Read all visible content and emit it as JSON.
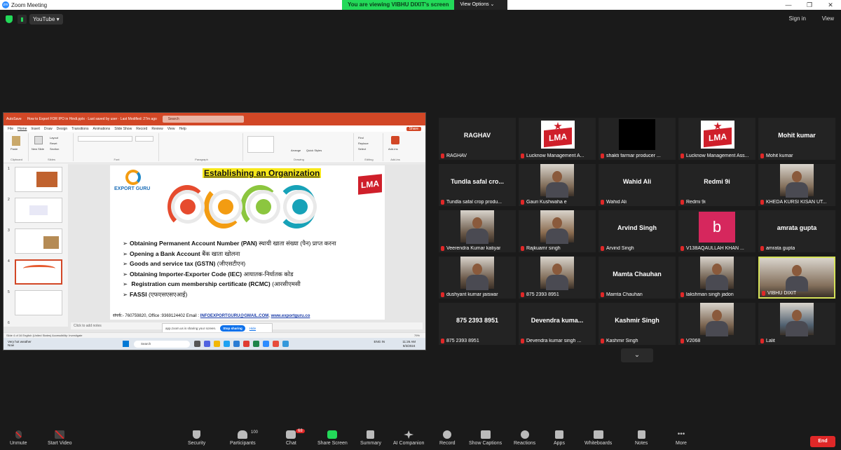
{
  "window": {
    "title": "Zoom Meeting",
    "min": "—",
    "max": "❐",
    "close": "✕"
  },
  "banner": {
    "viewing": "You are viewing VIBHU DIXIT's screen",
    "view_options": "View Options ⌄"
  },
  "topbar": {
    "youtube": "YouTube ▾",
    "sign_in": "Sign in",
    "view": "View"
  },
  "powerpoint": {
    "autosave": "AutoSave",
    "file_title": "How to Export FOR IPO in Hindi.pptx  ·  Last saved by user  ·  Last Modified: 27m ago",
    "search_placeholder": "Search",
    "menu": [
      "File",
      "Home",
      "Insert",
      "Draw",
      "Design",
      "Transitions",
      "Animations",
      "Slide Show",
      "Record",
      "Review",
      "View",
      "Help"
    ],
    "share": "Share",
    "ribbon_groups": [
      "Clipboard",
      "Slides",
      "Font",
      "Paragraph",
      "Drawing",
      "Editing",
      "Add-ins"
    ],
    "ribbon_buttons": {
      "paste": "Paste",
      "new_slide": "New Slide",
      "layout": "Layout",
      "reset": "Reset",
      "section": "Section",
      "arrange": "Arrange",
      "quick_styles": "Quick Styles",
      "find": "Find",
      "replace": "Replace",
      "select": "Select",
      "addins": "Add-ins"
    },
    "slide_numbers": [
      "1",
      "2",
      "3",
      "4",
      "5",
      "6"
    ],
    "notes": "Click to add notes",
    "status": "Slide 4 of 16    English (United States)    Accessibility: Investigate",
    "zoom": "79%"
  },
  "slide": {
    "title": "Establishing an Organization",
    "logo_left": "EXPORT GURU",
    "logo_right": "LMA",
    "bullets": [
      {
        "en": "Obtaining Permanent Account Number (PAN)",
        "hi": "स्थायी खाता संख्या (पैन) प्राप्त करना"
      },
      {
        "en": "Opening a Bank Account",
        "hi": "बैंक खाता खोलना"
      },
      {
        "en": "Goods and service tax (GSTN)",
        "hi": "(जीएसटीएन)"
      },
      {
        "en": "Obtaining Importer-Exporter Code (IEC)",
        "hi": "आयातक-निर्यातक कोड"
      },
      {
        "en": "Registration cum membership certificate (RCMC)",
        "hi": "(आरसीएमसी"
      },
      {
        "en": "FASSI",
        "hi": "(एफएसएसएआई)"
      }
    ],
    "contact_prefix": "संपर्क:- 760759820, Office :9369124402 Email :",
    "email": "INFOEXPORTGURU@GMAIL.COM",
    "website": "www.exportguru.co"
  },
  "sharing_bar": {
    "text": "app.zoom.us is sharing your screen.",
    "stop": "Stop sharing",
    "hide": "Hide"
  },
  "taskbar": {
    "weather": "Very hot weather",
    "weather_sub": "Now",
    "search": "Search",
    "lang": "ENG IN",
    "time": "11:26 AM",
    "date": "9/3/2024"
  },
  "colors": {
    "accent": "#2d8cff",
    "active_speaker": "#d6e35a",
    "green": "#23d959",
    "end": "#e02828",
    "powerpoint": "#d24726"
  },
  "participants": [
    {
      "big": "RAGHAV",
      "name": "RAGHAV",
      "kind": "text"
    },
    {
      "big": "",
      "name": "Lucknow Management A...",
      "kind": "lma"
    },
    {
      "big": "",
      "name": "shakti farmar producer ...",
      "kind": "black"
    },
    {
      "big": "",
      "name": "Lucknow Management Ass...",
      "kind": "lma"
    },
    {
      "big": "Mohit kumar",
      "name": "Mohit kumar",
      "kind": "text"
    },
    {
      "big": "Tundla safal  cro...",
      "name": "Tundla safal crop produ...",
      "kind": "text"
    },
    {
      "big": "",
      "name": "Gauri Kushwaha e",
      "kind": "video"
    },
    {
      "big": "Wahid Ali",
      "name": "Wahid Ali",
      "kind": "text"
    },
    {
      "big": "Redmi 9i",
      "name": "Redmi 9i",
      "kind": "text"
    },
    {
      "big": "",
      "name": "KHEDA KURSI KISAN UT...",
      "kind": "video"
    },
    {
      "big": "",
      "name": "Veerendra Kumar katiyar",
      "kind": "video"
    },
    {
      "big": "",
      "name": "Rajkuamr singh",
      "kind": "video"
    },
    {
      "big": "Arvind Singh",
      "name": "Arvind Singh",
      "kind": "text"
    },
    {
      "big": "b",
      "name": "V138AQAULLAH KHAN ...",
      "kind": "avatar"
    },
    {
      "big": "amrata gupta",
      "name": "amrata gupta",
      "kind": "text"
    },
    {
      "big": "",
      "name": "dushyant kumar jaiswar",
      "kind": "video"
    },
    {
      "big": "",
      "name": "875 2393 8951",
      "kind": "video"
    },
    {
      "big": "Mamta Chauhan",
      "name": "Mamta Chauhan",
      "kind": "text"
    },
    {
      "big": "",
      "name": "lakshman singh jadon",
      "kind": "video"
    },
    {
      "big": "",
      "name": "VIBHU DIXIT",
      "kind": "speaker"
    },
    {
      "big": "875 2393 8951",
      "name": "875 2393 8951",
      "kind": "text"
    },
    {
      "big": "Devendra  kuma...",
      "name": "Devendra kumar singh ...",
      "kind": "text"
    },
    {
      "big": "Kashmir Singh",
      "name": "Kashmir Singh",
      "kind": "text"
    },
    {
      "big": "",
      "name": "V2068",
      "kind": "video"
    },
    {
      "big": "",
      "name": "Lalit",
      "kind": "video"
    }
  ],
  "toolbar": {
    "unmute": "Unmute",
    "start_video": "Start Video",
    "security": "Security",
    "participants": "Participants",
    "participants_count": "100",
    "chat": "Chat",
    "chat_badge": "68",
    "share_screen": "Share Screen",
    "summary": "Summary",
    "ai_companion": "AI Companion",
    "record": "Record",
    "show_captions": "Show Captions",
    "reactions": "Reactions",
    "apps": "Apps",
    "whiteboards": "Whiteboards",
    "notes": "Notes",
    "more": "More",
    "end": "End"
  }
}
